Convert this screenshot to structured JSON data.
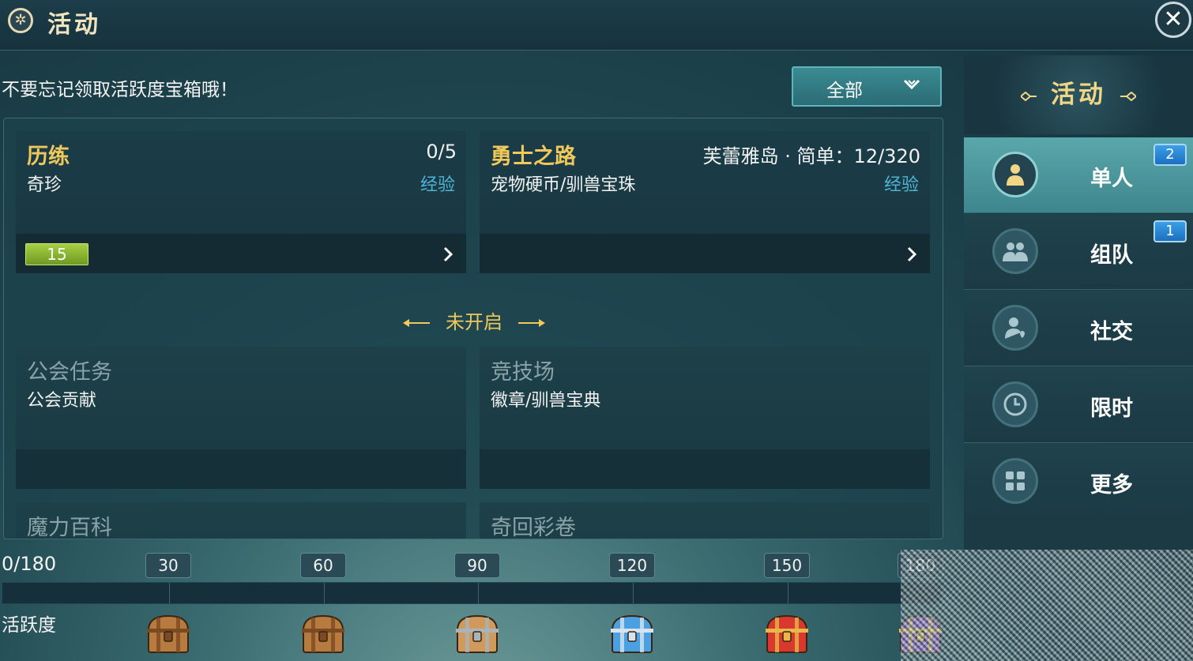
{
  "header": {
    "title": "活动"
  },
  "reminder": "不要忘记领取活跃度宝箱哦！",
  "filter": {
    "label": "全部"
  },
  "cards": [
    {
      "name": "历练",
      "reward": "奇珍",
      "count": "0/5",
      "tag": "经验",
      "level": "15"
    },
    {
      "name": "勇士之路",
      "reward": "宠物硬币/驯兽宝珠",
      "count": "芙蕾雅岛 · 简单：12/320",
      "tag": "经验"
    }
  ],
  "locked_section": {
    "title": "未开启"
  },
  "locked_cards": [
    {
      "name": "公会任务",
      "reward": "公会贡献"
    },
    {
      "name": "竞技场",
      "reward": "徽章/驯兽宝典"
    },
    {
      "name": "魔力百科"
    },
    {
      "name": "奇回彩卷"
    }
  ],
  "nav": {
    "title": "活动",
    "items": [
      {
        "label": "单人",
        "badge": "2",
        "icon": "person-icon",
        "active": true
      },
      {
        "label": "组队",
        "badge": "1",
        "icon": "team-icon"
      },
      {
        "label": "社交",
        "icon": "social-icon"
      },
      {
        "label": "限时",
        "icon": "clock-icon"
      },
      {
        "label": "更多",
        "icon": "grid-icon"
      }
    ]
  },
  "activity": {
    "label": "活跃度",
    "total": "0/180",
    "current": 0,
    "max": 180,
    "milestones": [
      "30",
      "60",
      "90",
      "120",
      "150",
      "180"
    ],
    "chests": [
      "wood-chest-icon",
      "wood-chest-icon",
      "bronze-chest-icon",
      "blue-chest-icon",
      "red-chest-icon",
      "purple-chest-icon"
    ]
  },
  "colors": {
    "accent": "#f0c95a",
    "tag": "#4fb4d6",
    "badge": "#1d6fbf",
    "level": "#8cbd30"
  }
}
